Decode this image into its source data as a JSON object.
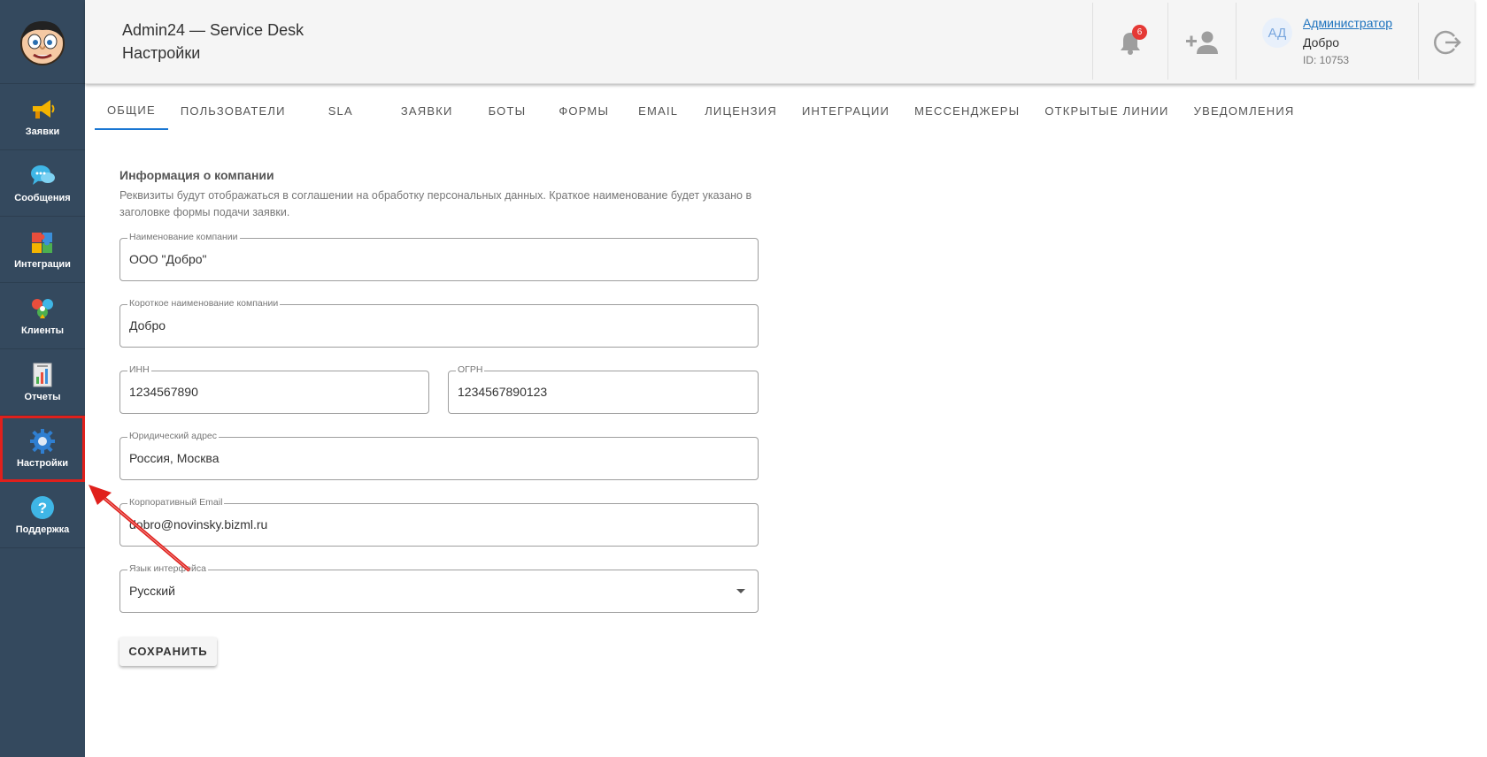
{
  "sidebar": {
    "items": [
      {
        "label": "Заявки",
        "icon": "megaphone-icon"
      },
      {
        "label": "Сообщения",
        "icon": "chat-bubbles-icon"
      },
      {
        "label": "Интеграции",
        "icon": "puzzle-icon"
      },
      {
        "label": "Клиенты",
        "icon": "people-icon"
      },
      {
        "label": "Отчеты",
        "icon": "report-chart-icon"
      },
      {
        "label": "Настройки",
        "icon": "gear-icon"
      },
      {
        "label": "Поддержка",
        "icon": "question-icon"
      }
    ],
    "active_index": 5
  },
  "header": {
    "app_title": "Admin24 — Service Desk",
    "page_title": "Настройки",
    "notifications_count": "6",
    "user": {
      "initials": "АД",
      "name": "Администратор",
      "org": "Добро",
      "id": "ID: 10753"
    }
  },
  "tabs": [
    "ОБЩИЕ",
    "ПОЛЬЗОВАТЕЛИ",
    "SLA",
    "ЗАЯВКИ",
    "БОТЫ",
    "ФОРМЫ",
    "EMAIL",
    "ЛИЦЕНЗИЯ",
    "ИНТЕГРАЦИИ",
    "МЕССЕНДЖЕРЫ",
    "ОТКРЫТЫЕ ЛИНИИ",
    "УВЕДОМЛЕНИЯ"
  ],
  "active_tab": "ОБЩИЕ",
  "company": {
    "title": "Информация о компании",
    "description": "Реквизиты будут отображаться в соглашении на обработку персональных данных. Краткое наименование будет указано в заголовке формы подачи заявки.",
    "fields": {
      "name": {
        "label": "Наименование компании",
        "value": "ООО \"Добро\""
      },
      "short_name": {
        "label": "Короткое наименование компании",
        "value": "Добро"
      },
      "inn": {
        "label": "ИНН",
        "value": "1234567890"
      },
      "ogrn": {
        "label": "ОГРН",
        "value": "1234567890123"
      },
      "address": {
        "label": "Юридический адрес",
        "value": "Россия, Москва"
      },
      "email": {
        "label": "Корпоративный Email",
        "value": "dobro@novinsky.bizml.ru"
      },
      "language": {
        "label": "Язык интерфейса",
        "value": "Русский"
      }
    },
    "save_label": "СОХРАНИТЬ"
  },
  "colors": {
    "sidebar_bg": "#34495e",
    "accent": "#1976d2",
    "highlight": "#e0201c",
    "badge": "#e53935"
  }
}
